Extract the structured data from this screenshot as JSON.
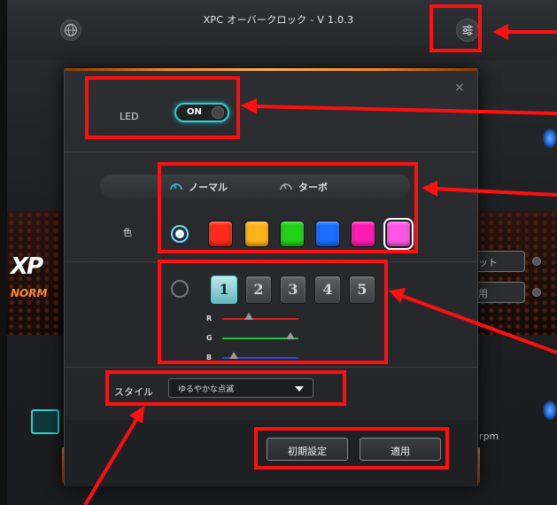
{
  "window": {
    "title": "XPC オーバークロック - V 1.0.3"
  },
  "colors": {
    "accent": "#39c9d0",
    "annotation": "#ff1010",
    "orange_glow": "#ff8a1a"
  },
  "background": {
    "logo_text": "XP",
    "logo_sub": "NORM",
    "right_buttons": [
      "ット",
      "用"
    ],
    "rpm_label": "rpm"
  },
  "dialog": {
    "close_symbol": "×",
    "led": {
      "label": "LED",
      "toggle_text": "ON",
      "state": "on"
    },
    "modes": [
      {
        "label": "ノーマル",
        "icon": "speedometer-icon",
        "selected": true
      },
      {
        "label": "ターボ",
        "icon": "speedometer-icon",
        "selected": false
      }
    ],
    "color_label": "色",
    "preset_colors": [
      "#ff2a1a",
      "#ffb21a",
      "#22d21a",
      "#1a6dff",
      "#ff1ab4",
      "#ff55e6"
    ],
    "selected_color_index": 5,
    "custom_slots": [
      "1",
      "2",
      "3",
      "4",
      "5"
    ],
    "selected_slot": "1",
    "rgb": [
      {
        "label": "R",
        "value": 0.35,
        "color": "#e01e1e"
      },
      {
        "label": "G",
        "value": 0.9,
        "color": "#1ec83a"
      },
      {
        "label": "B",
        "value": 0.15,
        "color": "#1e4ee0"
      }
    ],
    "style": {
      "label": "スタイル",
      "value": "ゆるやかな点滅"
    },
    "buttons": {
      "reset": "初期設定",
      "apply": "適用"
    }
  }
}
